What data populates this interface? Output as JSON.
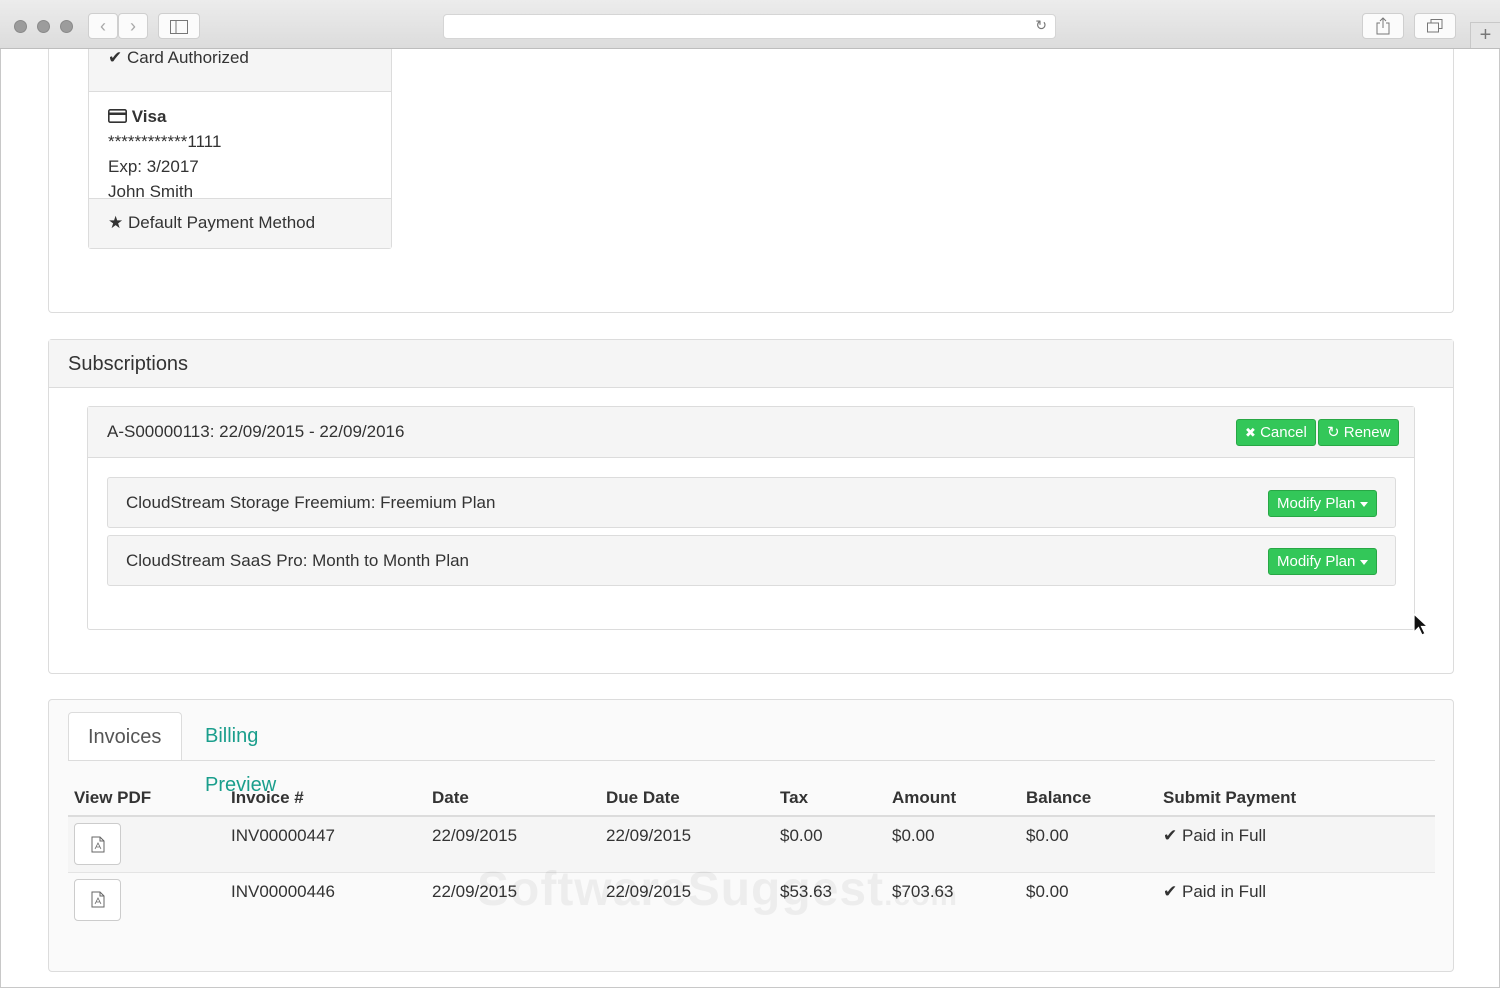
{
  "payment_method": {
    "status": "Card Authorized",
    "card_brand": "Visa",
    "card_number": "************1111",
    "expiry": "Exp: 3/2017",
    "holder": "John Smith",
    "default_label": "Default Payment Method"
  },
  "subscriptions": {
    "heading": "Subscriptions",
    "subscription": {
      "title": "A-S00000113: 22/09/2015 - 22/09/2016",
      "cancel_label": "Cancel",
      "renew_label": "Renew"
    },
    "plans": [
      {
        "name": "CloudStream Storage Freemium: Freemium Plan",
        "button": "Modify Plan"
      },
      {
        "name": "CloudStream SaaS Pro: Month to Month Plan",
        "button": "Modify Plan"
      }
    ]
  },
  "invoices": {
    "tabs": [
      "Invoices",
      "Billing Preview"
    ],
    "columns": [
      "View PDF",
      "Invoice #",
      "Date",
      "Due Date",
      "Tax",
      "Amount",
      "Balance",
      "Submit Payment"
    ],
    "rows": [
      {
        "invoice": "INV00000447",
        "date": "22/09/2015",
        "due": "22/09/2015",
        "tax": "$0.00",
        "amount": "$0.00",
        "balance": "$0.00",
        "payment": "Paid in Full"
      },
      {
        "invoice": "INV00000446",
        "date": "22/09/2015",
        "due": "22/09/2015",
        "tax": "$53.63",
        "amount": "$703.63",
        "balance": "$0.00",
        "payment": "Paid in Full"
      }
    ]
  },
  "watermark": {
    "main": "SoftwareSuggest",
    "suffix": ".com"
  },
  "colors": {
    "accent_green": "#33c759",
    "link_teal": "#1a9e8c"
  }
}
